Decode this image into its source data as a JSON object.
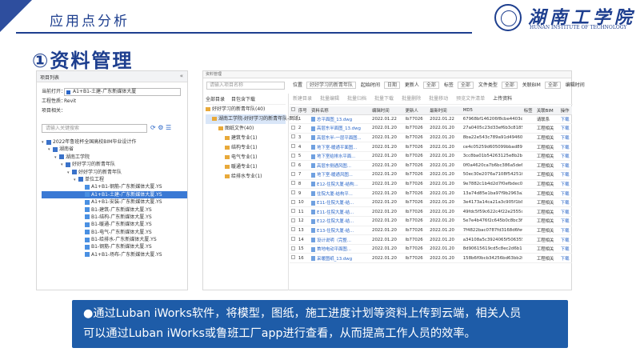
{
  "header": {
    "title": "应用点分析",
    "logo_cn": "湖南工学院",
    "logo_en": "HUNAN INSTITUTE OF TECHNOLOGY"
  },
  "section_title": "①资料管理",
  "left_panel": {
    "title": "项目列表",
    "collapse": "«",
    "open_label": "当前打开：",
    "open_value": "A1+B1-土建-广东新媒体大厦",
    "type_label": "工程性质：",
    "type_value": "Revit",
    "related_label": "项目相关：",
    "search_placeholder": "请输入关键搜索",
    "tree": [
      {
        "label": "2022年鲁班杯全国高校BIM毕业设计作",
        "indent": 0,
        "icon": "folder",
        "toggle": "▾",
        "selected": false
      },
      {
        "label": "湖南省",
        "indent": 1,
        "icon": "folder",
        "toggle": "▾",
        "selected": false
      },
      {
        "label": "湖南工学院",
        "indent": 2,
        "icon": "folder",
        "toggle": "▾",
        "selected": false
      },
      {
        "label": "好好学习的新青年队",
        "indent": 3,
        "icon": "folder",
        "toggle": "▾",
        "selected": false
      },
      {
        "label": "好好学习的新青年队",
        "indent": 4,
        "icon": "folder",
        "toggle": "▾",
        "selected": false
      },
      {
        "label": "单位工程",
        "indent": 5,
        "icon": "folder",
        "toggle": "▾",
        "selected": false
      },
      {
        "label": "A1+B1-钢筋-广东新媒体大厦.YS",
        "indent": 6,
        "icon": "file",
        "toggle": "",
        "selected": false
      },
      {
        "label": "A1+B1-土建-广东新媒体大厦.YS",
        "indent": 6,
        "icon": "file",
        "toggle": "",
        "selected": true
      },
      {
        "label": "A1+B1-安装-广东新媒体大厦.YS",
        "indent": 6,
        "icon": "file",
        "toggle": "",
        "selected": false
      },
      {
        "label": "B1-建筑-广东新媒体大厦.YS",
        "indent": 6,
        "icon": "file",
        "toggle": "",
        "selected": false
      },
      {
        "label": "B1-结构-广东新媒体大厦.YS",
        "indent": 6,
        "icon": "file",
        "toggle": "",
        "selected": false
      },
      {
        "label": "B1-暖通-广东新媒体大厦.YS",
        "indent": 6,
        "icon": "file",
        "toggle": "",
        "selected": false
      },
      {
        "label": "B1-电气-广东新媒体大厦.YS",
        "indent": 6,
        "icon": "file",
        "toggle": "",
        "selected": false
      },
      {
        "label": "B1-给排水-广东新媒体大厦.YS",
        "indent": 6,
        "icon": "file",
        "toggle": "",
        "selected": false
      },
      {
        "label": "B1-钢筋-广东新媒体大厦.YS",
        "indent": 6,
        "icon": "file",
        "toggle": "",
        "selected": false
      },
      {
        "label": "A1+B1-场布-广东新媒体大厦.YS",
        "indent": 6,
        "icon": "file",
        "toggle": "",
        "selected": false
      }
    ]
  },
  "right_panel": {
    "head": "资料管理",
    "search_placeholder": "请输入项目名称",
    "tb_all": "全部目录",
    "tb_docs": "目包含下载",
    "folder_tree": [
      {
        "label": "好好学习的新青年队(40)",
        "indent": 0,
        "selected": false
      },
      {
        "label": "湖南工学院-好好学习的新青年队-图纸",
        "indent": 1,
        "selected": true
      },
      {
        "label": "图纸文件(40)",
        "indent": 2,
        "selected": false
      },
      {
        "label": "建筑专业(1)",
        "indent": 3,
        "selected": false
      },
      {
        "label": "结构专业(1)",
        "indent": 3,
        "selected": false
      },
      {
        "label": "电气专业(1)",
        "indent": 3,
        "selected": false
      },
      {
        "label": "暖通专业(1)",
        "indent": 3,
        "selected": false
      },
      {
        "label": "给排水专业(1)",
        "indent": 3,
        "selected": false
      }
    ],
    "filters": {
      "location": "位置",
      "location_val": "好好学习的新青年队",
      "start_label": "起始时间",
      "start_val": "日期",
      "updater_label": "更新人",
      "updater_val": "全部",
      "tag_label": "标签",
      "tag_val": "全部",
      "type_label": "文件类型",
      "type_val": "全部",
      "bim_label": "关联BIM",
      "bim_val": "全部",
      "edit_label": "编辑时间"
    },
    "actions": [
      "新建目录",
      "批量编辑",
      "批量归档",
      "批量下载",
      "批量删除",
      "批量移动",
      "预览文件清单",
      "上传资料"
    ],
    "columns": [
      "序号",
      "资料名称",
      "编辑时间",
      "更新人",
      "最新时间",
      "MD5",
      "标签",
      "关联BIM",
      "操作"
    ],
    "rows": [
      [
        "1",
        "总平面图_13.dwg",
        "2022.01.22",
        "lb77026",
        "2022.01.22",
        "67968bf146206f8cbe4403d5a8a615",
        "",
        "请联系",
        "下载"
      ],
      [
        "2",
        "高层东半面图_13.dwg",
        "2022.01.20",
        "lb77026",
        "2022.01.20",
        "27a0405c23d33ef6b3c81850bdf97adb",
        "",
        "工程相关",
        "下载"
      ],
      [
        "3",
        "高层东半-一层平面图...",
        "2022.01.20",
        "lb77026",
        "2022.01.20",
        "8ba22e543c789a91d4946047d2f5b86",
        "",
        "工程相关",
        "下载"
      ],
      [
        "4",
        "地下室-暖通平面图...",
        "2022.01.20",
        "lb77026",
        "2022.01.20",
        "ce4c05259d605099bbad89a1ed59e69",
        "",
        "工程相关",
        "下载"
      ],
      [
        "5",
        "地下室给排水平面...",
        "2022.01.20",
        "lb77026",
        "2022.01.20",
        "3cc8ba01b54263125e8b2b2f9bc8e",
        "",
        "工程相关",
        "下载"
      ],
      [
        "6",
        "高层东侧通风图...",
        "2022.01.20",
        "lb77026",
        "2022.01.20",
        "0f0a4620ca7b6bc386a5de6658e55905",
        "",
        "工程相关",
        "下载"
      ],
      [
        "7",
        "地下室-暖通风图...",
        "2022.01.20",
        "lb77026",
        "2022.01.20",
        "50ec30e2076a7108f54251f2e9e2098f",
        "",
        "工程相关",
        "下载"
      ],
      [
        "8",
        "E12-住院大厦-结构...",
        "2022.01.20",
        "lb77026",
        "2022.01.20",
        "9e7882c1b4d2d7f0efbdec04e9e151f5a",
        "",
        "工程相关",
        "下载"
      ],
      [
        "9",
        "住院大厦-结构平...",
        "2022.01.20",
        "lb77026",
        "2022.01.20",
        "13a74d85e1ba97f9b2963a2849f51c8",
        "",
        "工程相关",
        "下载"
      ],
      [
        "10",
        "E11-住院大厦-结...",
        "2022.01.20",
        "lb77026",
        "2022.01.20",
        "3e4173a14ca21a3c905f1b8608fa259",
        "",
        "工程相关",
        "下载"
      ],
      [
        "11",
        "E11-住院大厦-结...",
        "2022.01.20",
        "lb77026",
        "2022.01.20",
        "49fdc5f59c622c4f22e2555c932d72e",
        "",
        "工程相关",
        "下载"
      ],
      [
        "12",
        "E12-住院大厦-结...",
        "2022.01.20",
        "lb77026",
        "2022.01.20",
        "5e7e4b476f2c645b0c8bc3f14f0698e61",
        "",
        "工程相关",
        "下载"
      ],
      [
        "13",
        "E13-住院大厦-结...",
        "2022.01.20",
        "lb77026",
        "2022.01.20",
        "7f4822bac0787fd3168d6fe6e94266e",
        "",
        "工程相关",
        "下载"
      ],
      [
        "14",
        "设计说明（完整...",
        "2022.01.20",
        "lb77026",
        "2022.01.20",
        "a34108a5c3924065f50635578f8b8746",
        "",
        "工程相关",
        "下载"
      ],
      [
        "15",
        "首地电动平面图...",
        "2022.01.20",
        "lb77026",
        "2022.01.20",
        "8d90615619cd5c8ec2d6b134e194057",
        "",
        "工程相关",
        "下载"
      ],
      [
        "16",
        "采暖图纸_13.dwg",
        "2022.01.20",
        "lb77026",
        "2022.01.20",
        "158b6f0bcb34256bd63bb2fb49409eb6",
        "",
        "工程相关",
        "下载"
      ]
    ]
  },
  "banner": {
    "line1": "●通过Luban iWorks软件，将模型，图纸，施工进度计划等资料上传到云端，相关人员",
    "line2": "可以通过Luban iWorks或鲁班工厂app进行查看，从而提高工作人员的效率。"
  },
  "colors": {
    "brand": "#1e3f8f",
    "banner": "#1e5ca8",
    "selection": "#3a79d4"
  }
}
